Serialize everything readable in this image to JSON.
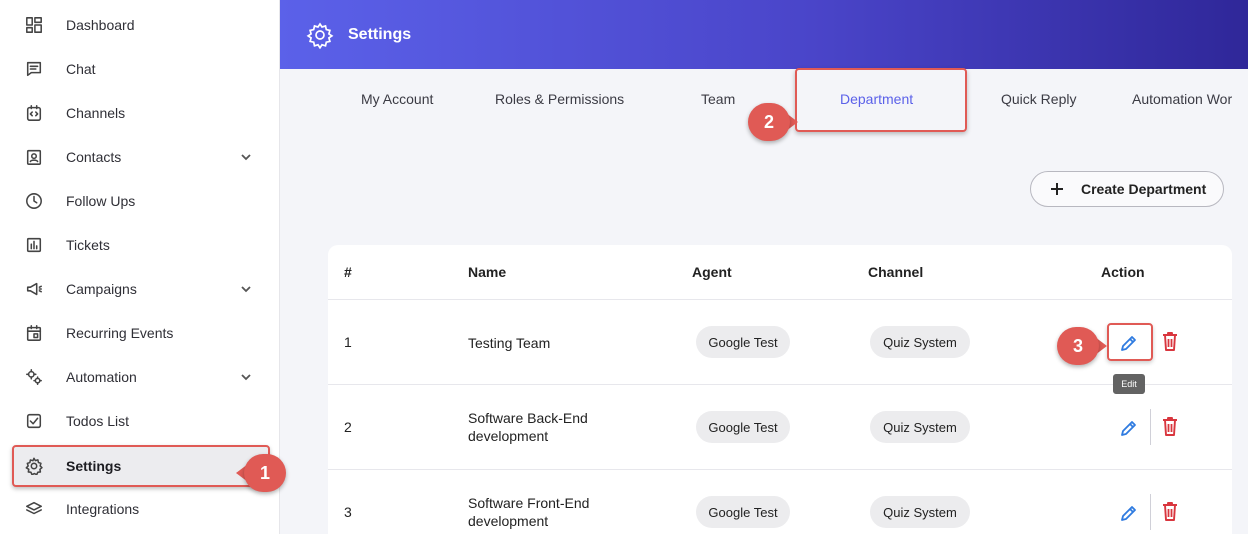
{
  "sidebar": {
    "items": [
      {
        "label": "Dashboard",
        "icon": "dashboard-icon"
      },
      {
        "label": "Chat",
        "icon": "chat-icon"
      },
      {
        "label": "Channels",
        "icon": "channels-icon"
      },
      {
        "label": "Contacts",
        "icon": "contacts-icon"
      },
      {
        "label": "Follow Ups",
        "icon": "clock-icon"
      },
      {
        "label": "Tickets",
        "icon": "tickets-icon"
      },
      {
        "label": "Campaigns",
        "icon": "megaphone-icon"
      },
      {
        "label": "Recurring Events",
        "icon": "calendar-icon"
      },
      {
        "label": "Automation",
        "icon": "gears-icon"
      },
      {
        "label": "Todos List",
        "icon": "checkbox-icon"
      },
      {
        "label": "Settings",
        "icon": "gear-icon"
      },
      {
        "label": "Integrations",
        "icon": "layers-icon"
      }
    ]
  },
  "header": {
    "title": "Settings"
  },
  "tabs": [
    {
      "label": "My Account"
    },
    {
      "label": "Roles & Permissions"
    },
    {
      "label": "Team"
    },
    {
      "label": "Department"
    },
    {
      "label": "Quick Reply"
    },
    {
      "label": "Automation Wor"
    }
  ],
  "create_button": {
    "label": "Create Department"
  },
  "table": {
    "headers": {
      "num": "#",
      "name": "Name",
      "agent": "Agent",
      "channel": "Channel",
      "action": "Action"
    },
    "rows": [
      {
        "num": "1",
        "name": "Testing Team",
        "agent": "Google Test",
        "channel": "Quiz System"
      },
      {
        "num": "2",
        "name": "Software Back-End development",
        "agent": "Google Test",
        "channel": "Quiz System"
      },
      {
        "num": "3",
        "name": "Software Front-End development",
        "agent": "Google Test",
        "channel": "Quiz System"
      }
    ]
  },
  "tooltip": {
    "text": "Edit"
  },
  "callouts": {
    "one": "1",
    "two": "2",
    "three": "3"
  },
  "colors": {
    "accent": "#5b61e9",
    "callout": "#e05a55",
    "delete": "#d9363e",
    "edit": "#2f7be0"
  }
}
